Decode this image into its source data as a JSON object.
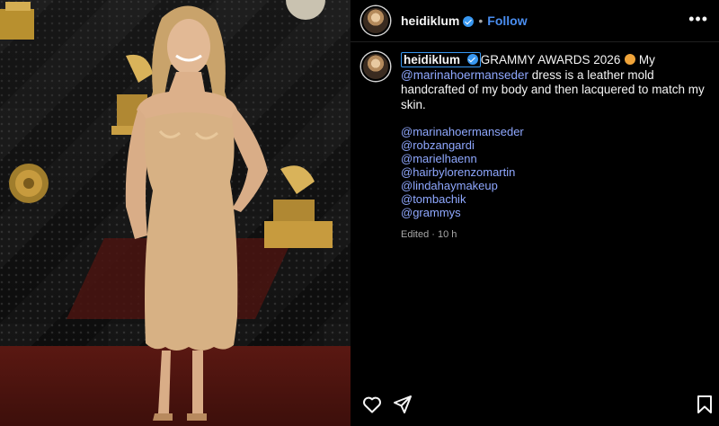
{
  "post": {
    "username": "heidiklum",
    "follow_label": "Follow",
    "separator": "•",
    "more_label": "•••"
  },
  "caption": {
    "username": "heidiklum",
    "text_start": "GRAMMY AWARDS 2026",
    "text_my": " My",
    "mention_main": "@marinahoermanseder",
    "text_rest": " dress is a leather mold handcrafted of my body and then lacquered to match my skin.",
    "mentions": [
      "@marinahoermanseder",
      "@robzangardi",
      "@marielhaenn",
      "@hairbylorenzomartin",
      "@lindahaymakeup",
      "@tombachik",
      "@grammys"
    ],
    "meta": "Edited · 10 h"
  },
  "icons": {
    "verified": "verified-badge-icon",
    "emoji": "cat-emoji-icon",
    "like": "heart-icon",
    "share": "paper-plane-icon",
    "save": "bookmark-icon"
  },
  "colors": {
    "accent": "#3897f0",
    "mention": "#8fa8ff",
    "background": "#000000"
  }
}
